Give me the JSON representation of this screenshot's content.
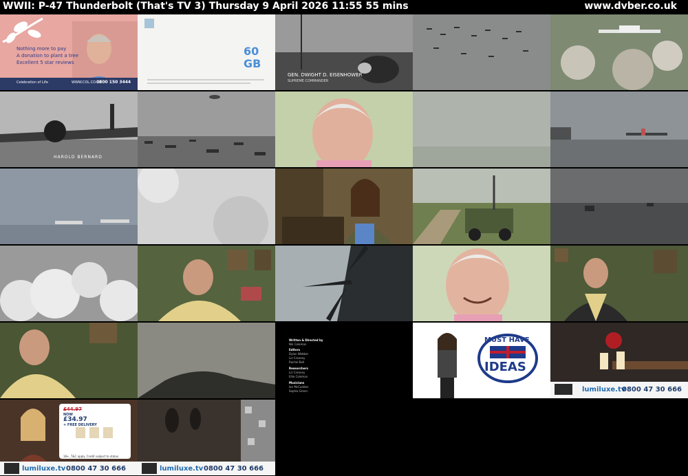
{
  "header": {
    "title": "WWII: P-47 Thunderbolt (That's TV 3)    Thursday 9 April 2026  11:55  55 mins",
    "site": "www.dvber.co.uk"
  },
  "ad_col": {
    "lines": [
      "Nothing more to pay",
      "A donation to plant a tree",
      "Excellent 5 star reviews"
    ],
    "brand": "Celebration of Life",
    "url": "WWW.COL.CO.UK",
    "phone": "0800 150 3444"
  },
  "ad_data": {
    "amount": "60",
    "unit": "GB"
  },
  "caption_eisenhower": {
    "line1": "GEN. DWIGHT D. EISENHOWER",
    "line2": "SUPREME COMMANDER"
  },
  "caption_bernard": "HAROLD BERNARD",
  "credits": [
    "Written & Directed by",
    "Nik Coleman",
    "Editors",
    "Dylan Webber",
    "Liz Creaney",
    "Rachel Bell",
    "Researchers",
    "Liz Creaney",
    "Ellie Coleman",
    "Musicians",
    "Ian McCuddon",
    "Sophia Green"
  ],
  "ad_ideas": {
    "line1": "MUST HAVE",
    "line2": "IDEAS"
  },
  "ad_lumi": {
    "brand": "lumiluxe.tv",
    "phone": "0800 47 30 666"
  },
  "ad_lumi2": {
    "was": "£44.97",
    "now_label": "NOW",
    "price": "£34.97",
    "delivery": "+ FREE DELIVERY",
    "terms": "18+, T&C apply. Credit subject to status.",
    "brand": "lumiluxe.tv",
    "phone": "0800 47 30 666"
  },
  "ad_lumi3": {
    "brand": "lumiluxe.tv",
    "phone": "0800 47 30 666"
  }
}
